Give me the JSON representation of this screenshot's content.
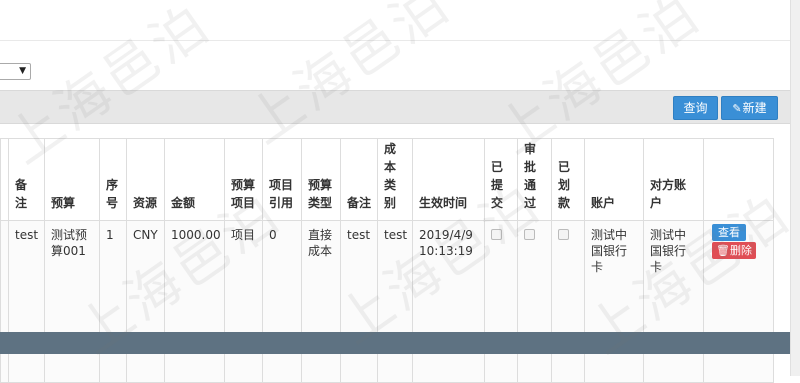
{
  "toolbar": {
    "query_label": "查询",
    "new_label": "新建"
  },
  "select": {
    "arrow": "▼"
  },
  "table": {
    "headers": [
      "备注",
      "预算",
      "序号",
      "资源",
      "金额",
      "预算项目",
      "项目引用",
      "预算类型",
      "备注",
      "成本类别",
      "生效时间",
      "已提交",
      "审批通过",
      "已划款",
      "账户",
      "对方账户",
      ""
    ],
    "row": {
      "remark": "test",
      "budget": "测试预算001",
      "seq": "1",
      "resource": "CNY",
      "amount": "1000.00",
      "budget_item": "项目",
      "item_ref": "0",
      "budget_type": "直接成本",
      "remark2": "test",
      "cost_type": "test",
      "effective_time": "2019/4/9 10:13:19",
      "submitted": false,
      "approved": false,
      "paid": false,
      "account": "测试中国银行卡",
      "counter_account": "测试中国银行卡",
      "view_label": "查看",
      "delete_label": "删除"
    }
  },
  "watermark": "上海邑泊"
}
